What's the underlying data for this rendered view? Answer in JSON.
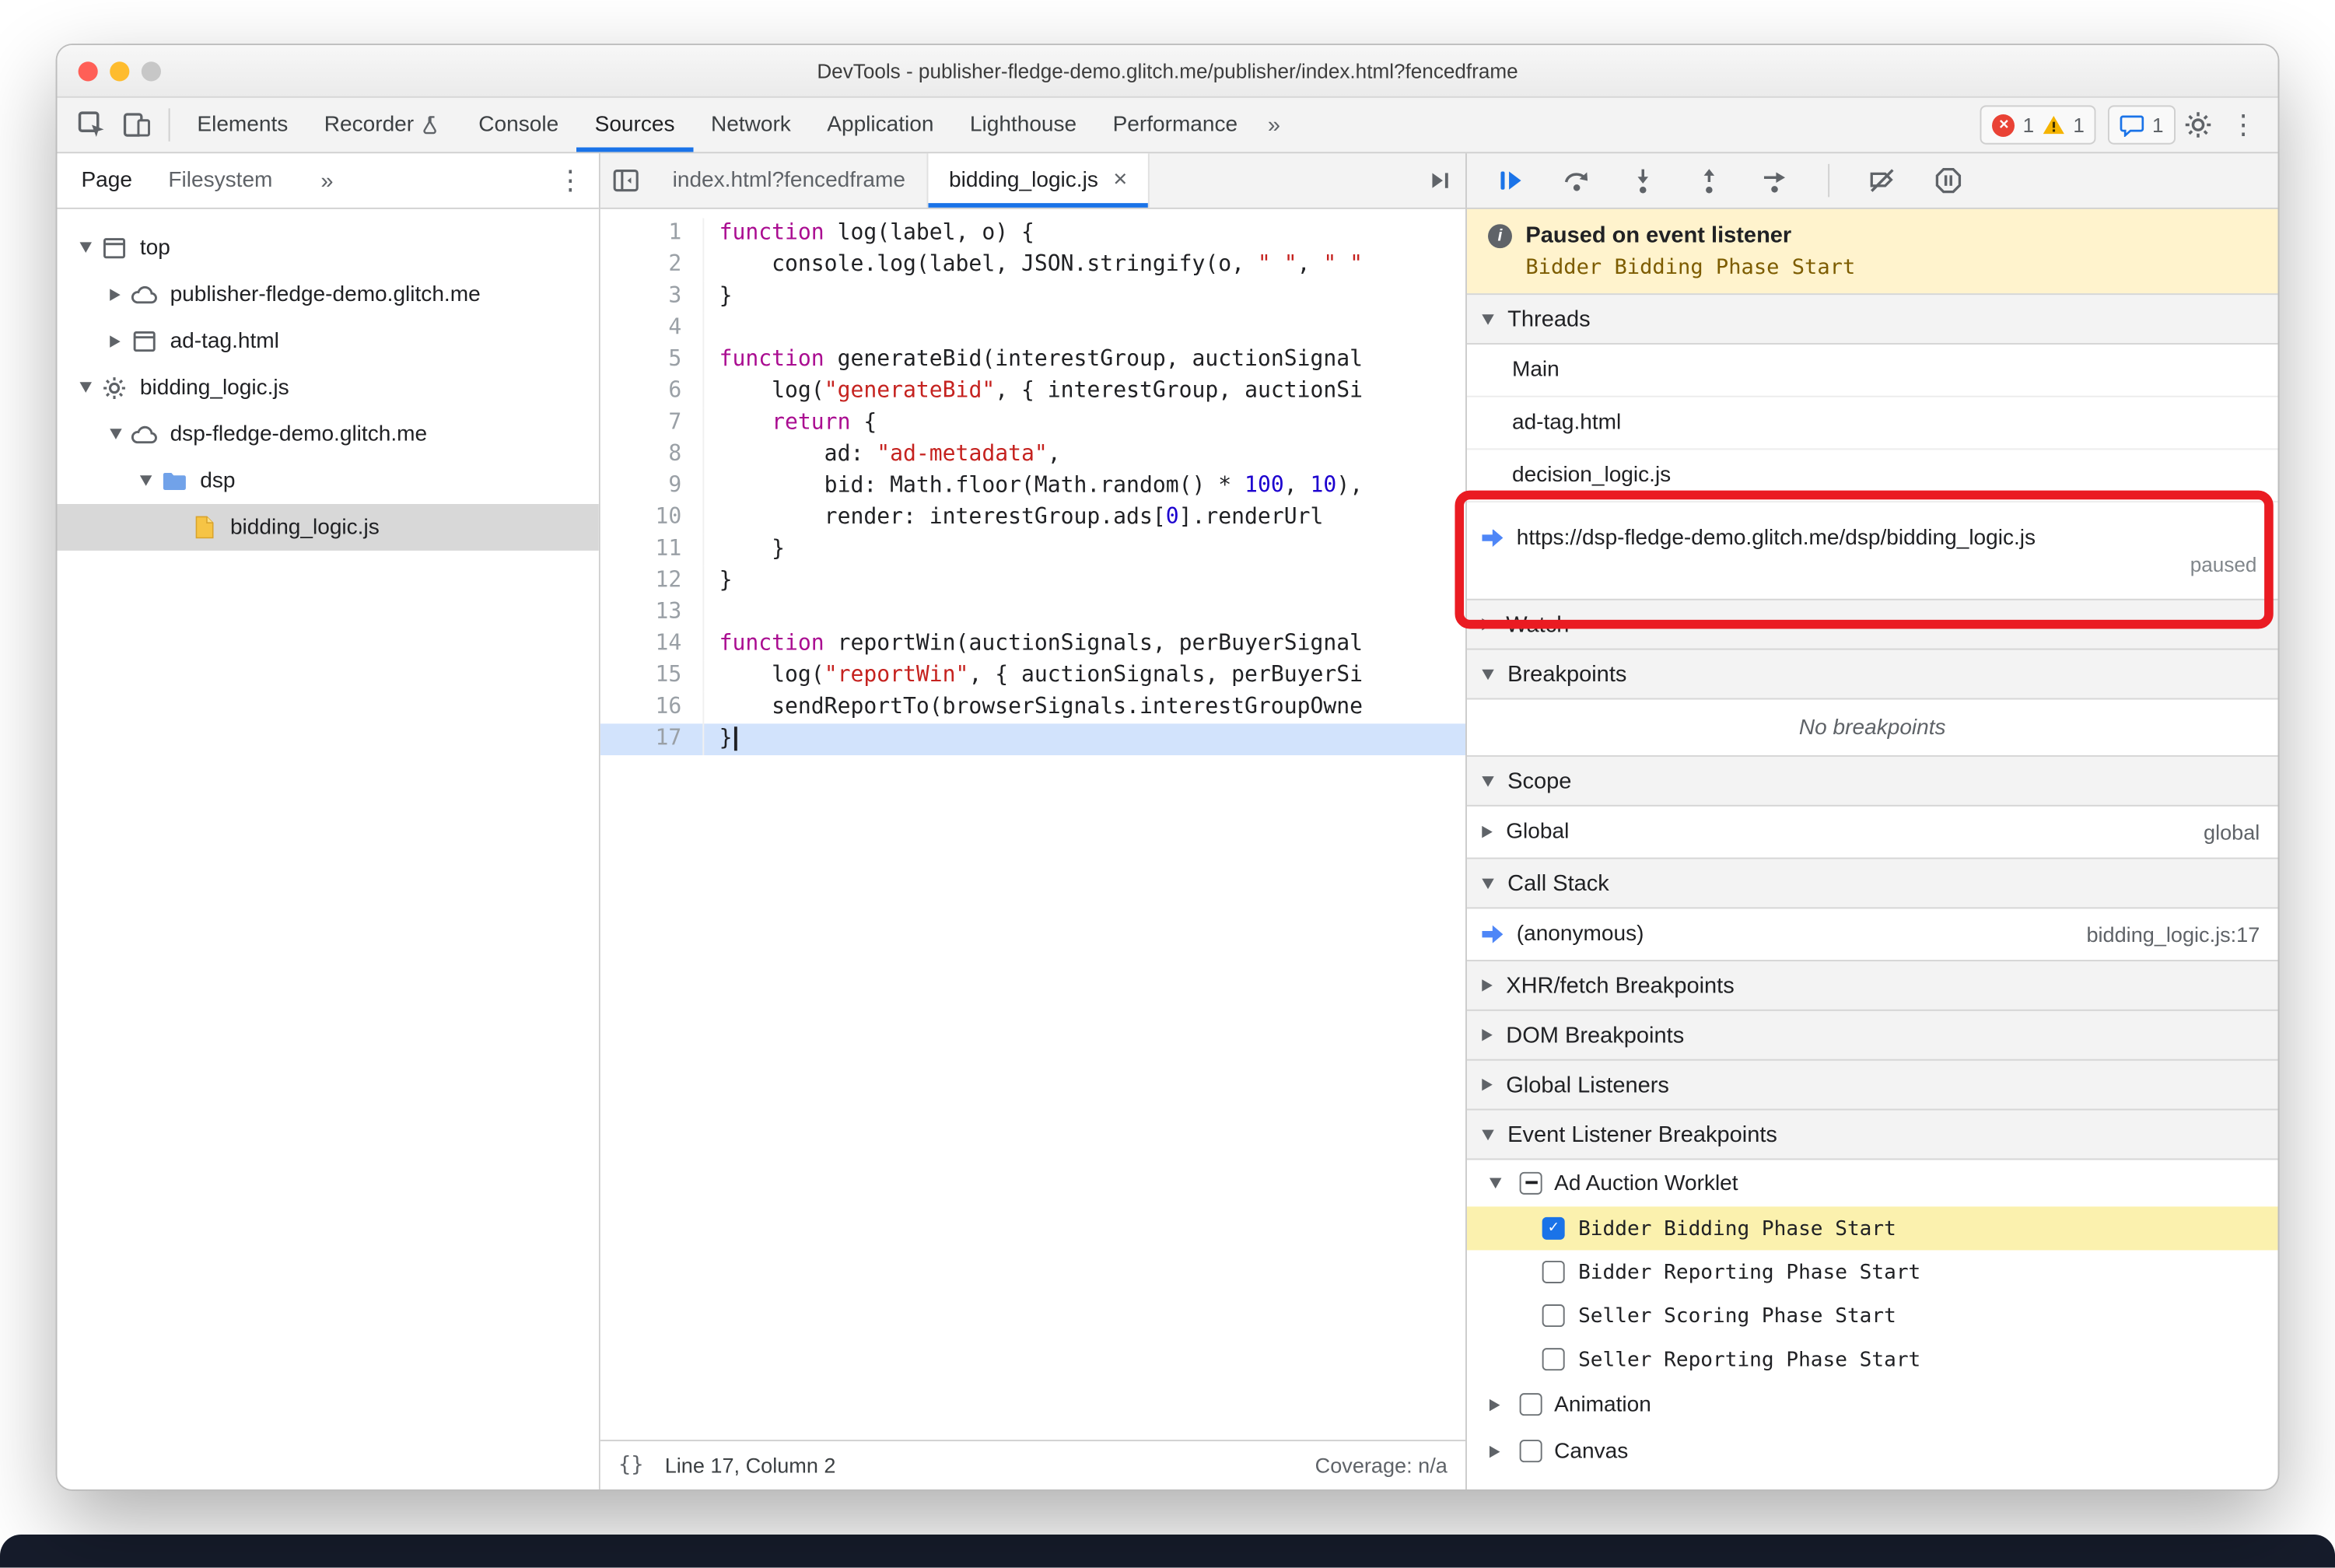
{
  "window": {
    "title": "DevTools - publisher-fledge-demo.glitch.me/publisher/index.html?fencedframe"
  },
  "glyphs": {
    "kebab": "⋮",
    "close_tab": "×",
    "pretty_print": "{}",
    "error_x": "×"
  },
  "main_toolbar": {
    "tabs": [
      {
        "label": "Elements"
      },
      {
        "label": "Recorder",
        "flask": true
      },
      {
        "label": "Console"
      },
      {
        "label": "Sources",
        "active": true
      },
      {
        "label": "Network"
      },
      {
        "label": "Application"
      },
      {
        "label": "Lighthouse"
      },
      {
        "label": "Performance"
      }
    ],
    "overflow_label": "»",
    "errors_count": "1",
    "warnings_count": "1",
    "issues_count": "1"
  },
  "navigator": {
    "tabs": [
      {
        "label": "Page",
        "active": true
      },
      {
        "label": "Filesystem"
      }
    ],
    "overflow_label": "»",
    "tree": [
      {
        "label": "top",
        "icon": "frame",
        "depth": 0,
        "state": "expanded"
      },
      {
        "label": "publisher-fledge-demo.glitch.me",
        "icon": "cloud",
        "depth": 1,
        "state": "collapsed"
      },
      {
        "label": "ad-tag.html",
        "icon": "frame",
        "depth": 1,
        "state": "collapsed"
      },
      {
        "label": "bidding_logic.js",
        "icon": "worklet",
        "depth": 0,
        "state": "expanded"
      },
      {
        "label": "dsp-fledge-demo.glitch.me",
        "icon": "cloud",
        "depth": 1,
        "state": "expanded"
      },
      {
        "label": "dsp",
        "icon": "folder",
        "depth": 2,
        "state": "expanded"
      },
      {
        "label": "bidding_logic.js",
        "icon": "file-js",
        "depth": 3,
        "state": "leaf",
        "selected": true
      }
    ]
  },
  "editor": {
    "tabs": [
      {
        "label": "index.html?fencedframe"
      },
      {
        "label": "bidding_logic.js",
        "active": true
      }
    ],
    "selected_line": 17,
    "code": [
      [
        [
          "k",
          "function"
        ],
        [
          "p",
          " log(label, o) {"
        ]
      ],
      [
        [
          "p",
          "    console.log(label, JSON.stringify(o, "
        ],
        [
          "s",
          "\" \""
        ],
        [
          "p",
          ", "
        ],
        [
          "s",
          "\" \""
        ]
      ],
      [
        [
          "p",
          "}"
        ]
      ],
      [],
      [
        [
          "k",
          "function"
        ],
        [
          "p",
          " generateBid(interestGroup, auctionSignal"
        ]
      ],
      [
        [
          "p",
          "    log("
        ],
        [
          "s",
          "\"generateBid\""
        ],
        [
          "p",
          ", { interestGroup, auctionSi"
        ]
      ],
      [
        [
          "k",
          "    return"
        ],
        [
          "p",
          " {"
        ]
      ],
      [
        [
          "p",
          "        ad: "
        ],
        [
          "s",
          "\"ad-metadata\""
        ],
        [
          "p",
          ","
        ]
      ],
      [
        [
          "p",
          "        bid: Math.floor(Math.random() * "
        ],
        [
          "n",
          "100"
        ],
        [
          "p",
          ", "
        ],
        [
          "n",
          "10"
        ],
        [
          "p",
          "),"
        ]
      ],
      [
        [
          "p",
          "        render: interestGroup.ads["
        ],
        [
          "n",
          "0"
        ],
        [
          "p",
          "].renderUrl"
        ]
      ],
      [
        [
          "p",
          "    }"
        ]
      ],
      [
        [
          "p",
          "}"
        ]
      ],
      [],
      [
        [
          "k",
          "function"
        ],
        [
          "p",
          " reportWin(auctionSignals, perBuyerSignal"
        ]
      ],
      [
        [
          "p",
          "    log("
        ],
        [
          "s",
          "\"reportWin\""
        ],
        [
          "p",
          ", { auctionSignals, perBuyerSi"
        ]
      ],
      [
        [
          "p",
          "    sendReportTo(browserSignals.interestGroupOwne"
        ]
      ],
      [
        [
          "p",
          "}"
        ]
      ]
    ],
    "status": {
      "line_info": "Line 17, Column 2",
      "coverage": "Coverage: n/a"
    }
  },
  "debugger": {
    "banner": {
      "title": "Paused on event listener",
      "detail": "Bidder Bidding Phase Start"
    },
    "threads": {
      "title": "Threads",
      "items": [
        {
          "label": "Main"
        },
        {
          "label": "ad-tag.html"
        },
        {
          "label": "decision_logic.js"
        },
        {
          "label": "https://dsp-fledge-demo.glitch.me/dsp/bidding_logic.js",
          "status": "paused",
          "current": true
        }
      ]
    },
    "watch": {
      "title": "Watch"
    },
    "breakpoints": {
      "title": "Breakpoints",
      "empty": "No breakpoints"
    },
    "scope": {
      "title": "Scope",
      "items": [
        {
          "label": "Global",
          "value": "global"
        }
      ]
    },
    "call_stack": {
      "title": "Call Stack",
      "items": [
        {
          "label": "(anonymous)",
          "location": "bidding_logic.js:17",
          "current": true
        }
      ]
    },
    "xhr_breakpoints": {
      "title": "XHR/fetch Breakpoints"
    },
    "dom_breakpoints": {
      "title": "DOM Breakpoints"
    },
    "global_listeners": {
      "title": "Global Listeners"
    },
    "event_listener_breakpoints": {
      "title": "Event Listener Breakpoints",
      "groups": [
        {
          "label": "Ad Auction Worklet",
          "checkbox": "indeterminate",
          "state": "expanded",
          "children": [
            {
              "label": "Bidder Bidding Phase Start",
              "checked": true,
              "highlighted": true
            },
            {
              "label": "Bidder Reporting Phase Start",
              "checked": false
            },
            {
              "label": "Seller Scoring Phase Start",
              "checked": false
            },
            {
              "label": "Seller Reporting Phase Start",
              "checked": false
            }
          ]
        },
        {
          "label": "Animation",
          "checkbox": "unchecked",
          "state": "collapsed",
          "children": []
        },
        {
          "label": "Canvas",
          "checkbox": "unchecked",
          "state": "collapsed",
          "children": []
        }
      ]
    }
  }
}
